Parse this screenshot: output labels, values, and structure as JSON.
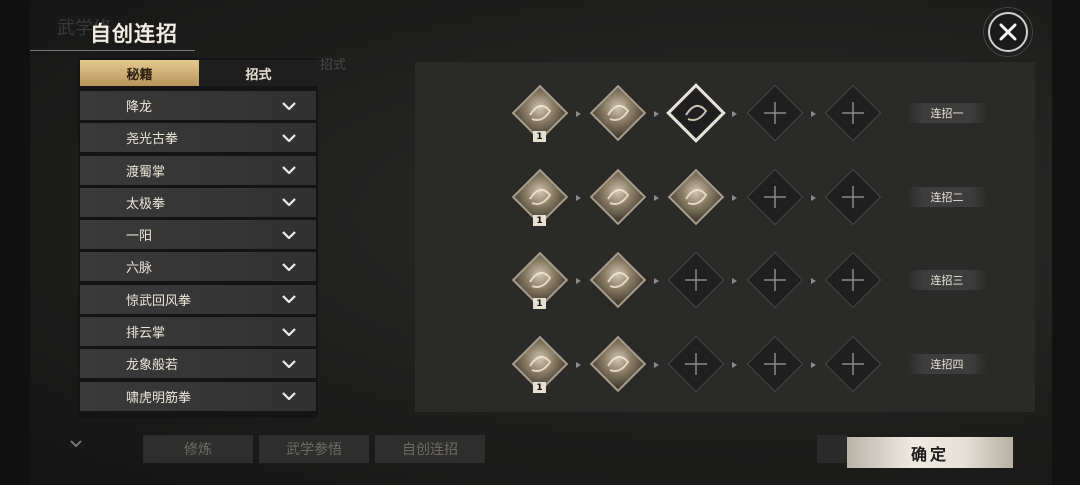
{
  "dialog": {
    "title": "自创连招",
    "close_icon": "close-icon",
    "background_title": "武学修",
    "background_tab": "招式"
  },
  "tabs": [
    {
      "label": "秘籍",
      "active": true
    },
    {
      "label": "招式",
      "active": false
    }
  ],
  "skill_list": [
    "降龙",
    "尧光古拳",
    "渡蜀掌",
    "太极拳",
    "一阳",
    "六脉",
    "惊武回风拳",
    "排云掌",
    "龙象般若",
    "啸虎明筋拳"
  ],
  "combos": [
    {
      "label": "连招一",
      "slots": [
        {
          "state": "filled",
          "badge": "1"
        },
        {
          "state": "filled"
        },
        {
          "state": "selected"
        },
        {
          "state": "empty"
        },
        {
          "state": "empty"
        }
      ]
    },
    {
      "label": "连招二",
      "slots": [
        {
          "state": "filled",
          "badge": "1"
        },
        {
          "state": "filled"
        },
        {
          "state": "filled"
        },
        {
          "state": "empty"
        },
        {
          "state": "empty"
        }
      ]
    },
    {
      "label": "连招三",
      "slots": [
        {
          "state": "filled",
          "badge": "1"
        },
        {
          "state": "filled"
        },
        {
          "state": "empty"
        },
        {
          "state": "empty"
        },
        {
          "state": "empty"
        }
      ]
    },
    {
      "label": "连招四",
      "slots": [
        {
          "state": "filled",
          "badge": "1"
        },
        {
          "state": "filled"
        },
        {
          "state": "empty"
        },
        {
          "state": "empty"
        },
        {
          "state": "empty"
        }
      ]
    }
  ],
  "bottom_buttons": [
    "修炼",
    "武学参悟",
    "自创连招"
  ],
  "confirm_label": "确定",
  "colors": {
    "accent_gold": "#d9bd82",
    "panel": "#2a2a29",
    "list_item": "#363636"
  }
}
